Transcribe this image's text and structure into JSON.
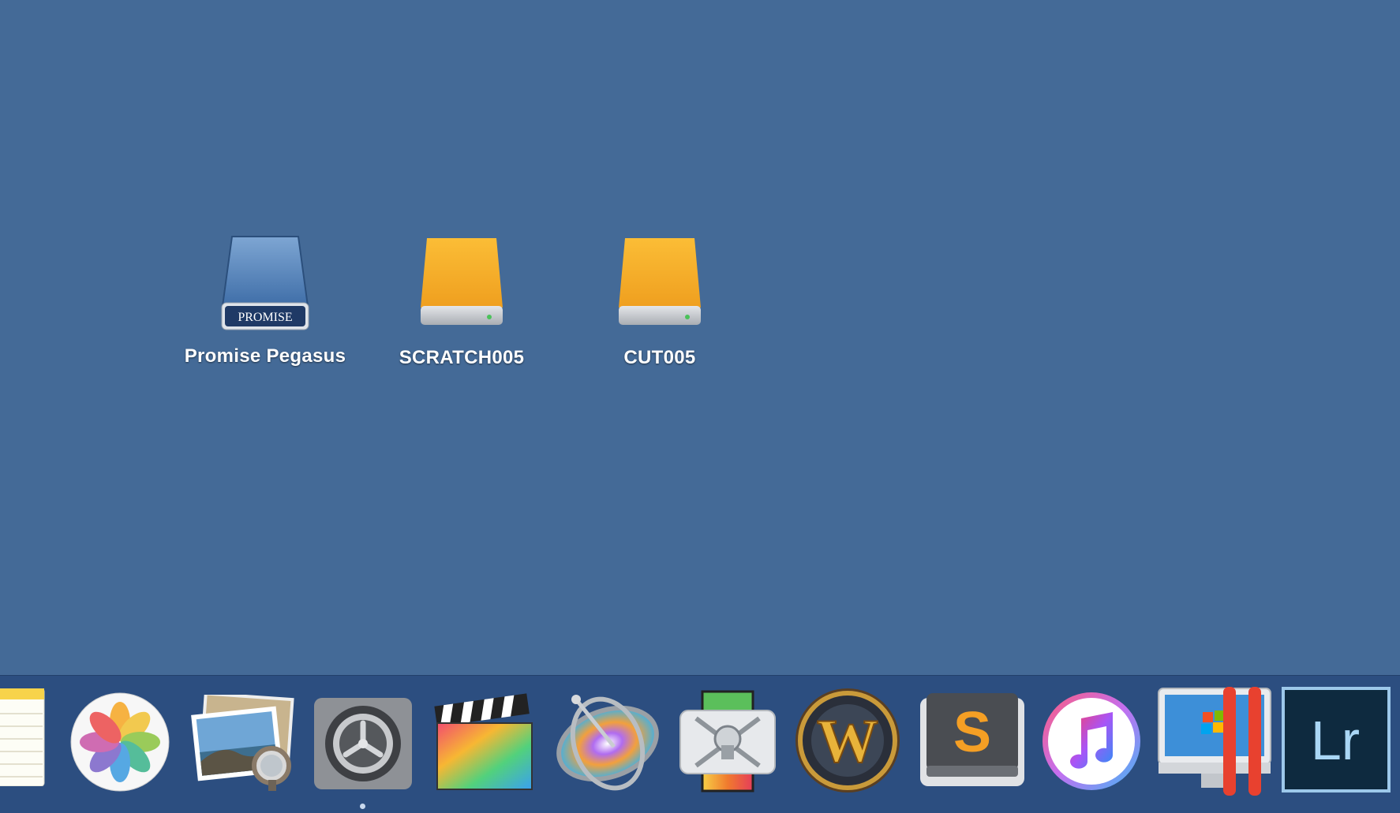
{
  "desktop": {
    "drives": [
      {
        "label": "Promise Pegasus",
        "icon": "promise-raid-drive-icon",
        "badge": "PROMISE"
      },
      {
        "label": "SCRATCH005",
        "icon": "external-drive-icon"
      },
      {
        "label": "CUT005",
        "icon": "external-drive-icon"
      }
    ]
  },
  "dock": {
    "items": [
      {
        "name": "notes-app-icon"
      },
      {
        "name": "photos-app-icon"
      },
      {
        "name": "preview-app-icon"
      },
      {
        "name": "system-preferences-app-icon",
        "running": true
      },
      {
        "name": "final-cut-pro-app-icon"
      },
      {
        "name": "motion-app-icon"
      },
      {
        "name": "compressor-app-icon"
      },
      {
        "name": "world-of-warcraft-app-icon",
        "letter": "W"
      },
      {
        "name": "sublime-text-app-icon",
        "letter": "S"
      },
      {
        "name": "itunes-app-icon"
      },
      {
        "name": "parallels-desktop-app-icon"
      },
      {
        "name": "lightroom-app-icon",
        "letters": "Lr"
      }
    ]
  },
  "colors": {
    "desktop_bg": "#446a97",
    "dock_bg": "#2c4e80",
    "drive_orange": "#f5a623",
    "promise_blue": "#3f6ea8"
  }
}
